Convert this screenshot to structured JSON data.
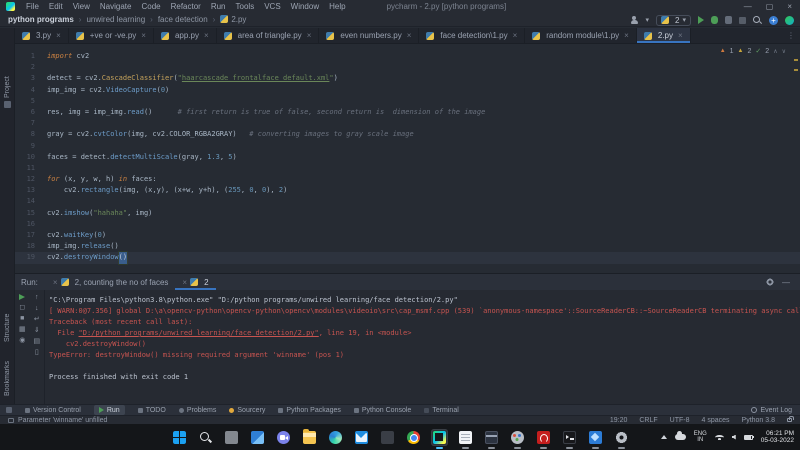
{
  "titlebar": {
    "title": "pycharm - 2.py [python programs]",
    "menus": [
      "File",
      "Edit",
      "View",
      "Navigate",
      "Code",
      "Refactor",
      "Run",
      "Tools",
      "VCS",
      "Window",
      "Help"
    ]
  },
  "breadcrumb": {
    "items": [
      "python programs",
      "unwired learning",
      "face detection",
      "2.py"
    ]
  },
  "toolbar": {
    "run_config": "2"
  },
  "tabs": [
    {
      "label": "3.py"
    },
    {
      "label": "+ve or -ve.py"
    },
    {
      "label": "app.py"
    },
    {
      "label": "area of triangle.py"
    },
    {
      "label": "even numbers.py"
    },
    {
      "label": "face detection\\1.py"
    },
    {
      "label": "random module\\1.py"
    },
    {
      "label": "2.py",
      "active": true
    }
  ],
  "inspection": {
    "errors": "1",
    "warnings": "2",
    "ok": "2"
  },
  "leftstrip": {
    "project": "Project",
    "structure": "Structure",
    "bookmarks": "Bookmarks"
  },
  "editor": {
    "lines": [
      {
        "n": "1",
        "toks": [
          [
            "kw",
            "import"
          ],
          [
            "pl",
            " cv2"
          ]
        ]
      },
      {
        "n": "2",
        "toks": []
      },
      {
        "n": "3",
        "toks": [
          [
            "pl",
            "detect = cv2."
          ],
          [
            "cls",
            "CascadeClassifier"
          ],
          [
            "pl",
            "("
          ],
          [
            "str",
            "\""
          ],
          [
            "stru",
            "haarcascade_frontalface_default.xml"
          ],
          [
            "str",
            "\""
          ],
          [
            "pl",
            ")"
          ]
        ]
      },
      {
        "n": "4",
        "toks": [
          [
            "pl",
            "imp_img = cv2."
          ],
          [
            "fn",
            "VideoCapture"
          ],
          [
            "pl",
            "("
          ],
          [
            "num",
            "0"
          ],
          [
            "pl",
            ")"
          ]
        ]
      },
      {
        "n": "5",
        "toks": []
      },
      {
        "n": "6",
        "toks": [
          [
            "pl",
            "res, img = imp_img."
          ],
          [
            "fn",
            "read"
          ],
          [
            "pl",
            "()      "
          ],
          [
            "com",
            "# first return is true of false, second return is  dimension of the image"
          ]
        ]
      },
      {
        "n": "7",
        "toks": []
      },
      {
        "n": "8",
        "toks": [
          [
            "pl",
            "gray = cv2."
          ],
          [
            "fn",
            "cvtColor"
          ],
          [
            "pl",
            "(img, cv2.COLOR_RGBA2GRAY)   "
          ],
          [
            "com",
            "# converting images to gray scale image"
          ]
        ]
      },
      {
        "n": "9",
        "toks": []
      },
      {
        "n": "10",
        "toks": [
          [
            "pl",
            "faces = detect."
          ],
          [
            "fn",
            "detectMultiScale"
          ],
          [
            "pl",
            "(gray, "
          ],
          [
            "num",
            "1.3"
          ],
          [
            "pl",
            ", "
          ],
          [
            "num",
            "5"
          ],
          [
            "pl",
            ")"
          ]
        ]
      },
      {
        "n": "11",
        "toks": []
      },
      {
        "n": "12",
        "toks": [
          [
            "kw",
            "for"
          ],
          [
            "pl",
            " (x, y, w, h) "
          ],
          [
            "kw",
            "in"
          ],
          [
            "pl",
            " faces:"
          ]
        ]
      },
      {
        "n": "13",
        "toks": [
          [
            "pl",
            "    cv2."
          ],
          [
            "fn",
            "rectangle"
          ],
          [
            "pl",
            "(img, (x,y), (x+w, y+h), ("
          ],
          [
            "num",
            "255"
          ],
          [
            "pl",
            ", "
          ],
          [
            "num",
            "0"
          ],
          [
            "pl",
            ", "
          ],
          [
            "num",
            "0"
          ],
          [
            "pl",
            "), "
          ],
          [
            "num",
            "2"
          ],
          [
            "pl",
            ")"
          ]
        ]
      },
      {
        "n": "14",
        "toks": []
      },
      {
        "n": "15",
        "toks": [
          [
            "pl",
            "cv2."
          ],
          [
            "fn",
            "imshow"
          ],
          [
            "pl",
            "("
          ],
          [
            "str",
            "\"hahaha\""
          ],
          [
            "pl",
            ", img)"
          ]
        ]
      },
      {
        "n": "16",
        "toks": []
      },
      {
        "n": "17",
        "toks": [
          [
            "pl",
            "cv2."
          ],
          [
            "fn",
            "waitKey"
          ],
          [
            "pl",
            "("
          ],
          [
            "num",
            "0"
          ],
          [
            "pl",
            ")"
          ]
        ]
      },
      {
        "n": "18",
        "toks": [
          [
            "pl",
            "imp_img."
          ],
          [
            "fn",
            "release"
          ],
          [
            "pl",
            "()"
          ]
        ]
      },
      {
        "n": "19",
        "cur": true,
        "toks": [
          [
            "pl",
            "cv2."
          ],
          [
            "fn",
            "destroyWindow"
          ],
          [
            "sel",
            "()"
          ]
        ]
      }
    ]
  },
  "run_panel": {
    "label": "Run:",
    "tabs": [
      {
        "label": "2, counting the no of faces"
      },
      {
        "label": "2",
        "active": true
      }
    ],
    "toolbar_left": [
      "rerun",
      "wrench",
      "stop",
      "layout",
      "pin"
    ],
    "toolbar_right": [
      "up",
      "down",
      "soft-wrap",
      "scroll-end",
      "print",
      "clear"
    ],
    "console": [
      {
        "toks": [
          [
            "out",
            "\"C:\\Program Files\\python3.8\\python.exe\" \"D:/python programs/unwired learning/face detection/2.py\""
          ]
        ]
      },
      {
        "toks": [
          [
            "err",
            "[ WARN:0@7.356] global D:\\a\\opencv-python\\opencv-python\\opencv\\modules\\videoio\\src\\cap_msmf.cpp (539) `anonymous-namespace'::SourceReaderCB::~SourceReaderCB terminating async callb"
          ]
        ]
      },
      {
        "toks": [
          [
            "err",
            "Traceback (most recent call last):"
          ]
        ]
      },
      {
        "toks": [
          [
            "err",
            "  File "
          ],
          [
            "link",
            "\"D:/python programs/unwired learning/face detection/2.py\""
          ],
          [
            "err",
            ", line 19, in <module>"
          ]
        ]
      },
      {
        "toks": [
          [
            "err",
            "    cv2.destroyWindow()"
          ]
        ]
      },
      {
        "toks": [
          [
            "err",
            "TypeError: destroyWindow() missing required argument 'winname' (pos 1)"
          ]
        ]
      },
      {
        "toks": []
      },
      {
        "toks": [
          [
            "out",
            "Process finished with exit code 1"
          ]
        ]
      }
    ]
  },
  "toolwindow_bar": {
    "items": [
      {
        "label": "Version Control",
        "icon": "vcs"
      },
      {
        "label": "Run",
        "icon": "run",
        "active": true
      },
      {
        "label": "TODO",
        "icon": "todo"
      },
      {
        "label": "Problems",
        "icon": "problems"
      },
      {
        "label": "Sourcery",
        "icon": "sourcery"
      },
      {
        "label": "Python Packages",
        "icon": "packages"
      },
      {
        "label": "Python Console",
        "icon": "pyconsole"
      },
      {
        "label": "Terminal",
        "icon": "terminal"
      }
    ],
    "event_log": "Event Log"
  },
  "statusbar": {
    "message": "Parameter 'winname' unfilled",
    "caret": "19:20",
    "line_ending": "CRLF",
    "encoding": "UTF-8",
    "indent": "4 spaces",
    "interpreter": "Python 3.8"
  },
  "taskbar": {
    "icons": [
      {
        "name": "start"
      },
      {
        "name": "search"
      },
      {
        "name": "taskview"
      },
      {
        "name": "widgets"
      },
      {
        "name": "chat"
      },
      {
        "name": "explorer"
      },
      {
        "name": "edge"
      },
      {
        "name": "mail"
      },
      {
        "name": "appdark"
      },
      {
        "name": "chrome"
      },
      {
        "name": "pycharm",
        "active": true,
        "open": true
      },
      {
        "name": "doc",
        "open": true
      },
      {
        "name": "card",
        "open": true
      },
      {
        "name": "gimp",
        "open": true
      },
      {
        "name": "acrobat",
        "open": true
      },
      {
        "name": "terminal",
        "open": true
      },
      {
        "name": "photos",
        "open": true
      },
      {
        "name": "settings",
        "open": true
      }
    ],
    "tray": {
      "lang_top": "ENG",
      "lang_bottom": "IN",
      "time": "06:21 PM",
      "date": "05-03-2022"
    }
  },
  "colors": {
    "accent_blue": "#3874c0",
    "stderr_red": "#c75450",
    "string_green": "#6a8759",
    "keyword_orange": "#cc8242"
  }
}
